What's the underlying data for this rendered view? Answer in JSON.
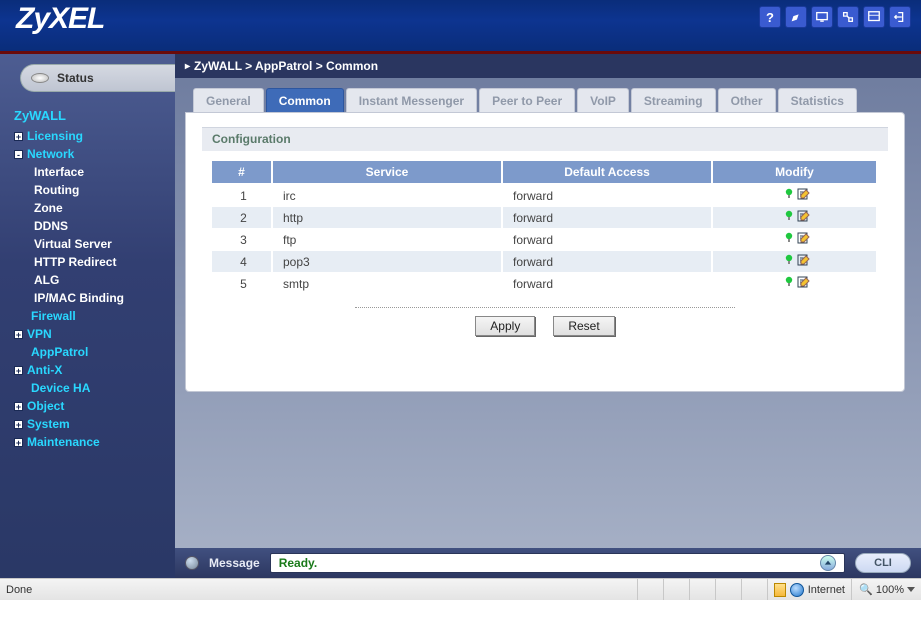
{
  "brand": "ZyXEL",
  "header_icons": [
    "help-icon",
    "wizard-icon",
    "console-icon",
    "connect-icon",
    "sitemap-icon",
    "logout-icon"
  ],
  "status_label": "Status",
  "breadcrumb": [
    "ZyWALL",
    "AppPatrol",
    "Common"
  ],
  "nav": {
    "root": "ZyWALL",
    "items": [
      {
        "label": "Licensing",
        "expandable": true,
        "sign": "+"
      },
      {
        "label": "Network",
        "expandable": true,
        "sign": "-",
        "children": [
          {
            "label": "Interface"
          },
          {
            "label": "Routing"
          },
          {
            "label": "Zone"
          },
          {
            "label": "DDNS"
          },
          {
            "label": "Virtual Server"
          },
          {
            "label": "HTTP Redirect"
          },
          {
            "label": "ALG"
          },
          {
            "label": "IP/MAC Binding"
          }
        ]
      },
      {
        "label": "Firewall",
        "expandable": false,
        "link": true
      },
      {
        "label": "VPN",
        "expandable": true,
        "sign": "+"
      },
      {
        "label": "AppPatrol",
        "expandable": false,
        "link": true,
        "active": true
      },
      {
        "label": "Anti-X",
        "expandable": true,
        "sign": "+"
      },
      {
        "label": "Device HA",
        "expandable": false,
        "link": true
      },
      {
        "label": "Object",
        "expandable": true,
        "sign": "+"
      },
      {
        "label": "System",
        "expandable": true,
        "sign": "+"
      },
      {
        "label": "Maintenance",
        "expandable": true,
        "sign": "+"
      }
    ]
  },
  "tabs": [
    {
      "label": "General",
      "active": false
    },
    {
      "label": "Common",
      "active": true
    },
    {
      "label": "Instant Messenger",
      "active": false
    },
    {
      "label": "Peer to Peer",
      "active": false
    },
    {
      "label": "VoIP",
      "active": false
    },
    {
      "label": "Streaming",
      "active": false
    },
    {
      "label": "Other",
      "active": false
    },
    {
      "label": "Statistics",
      "active": false
    }
  ],
  "section_title": "Configuration",
  "table": {
    "headers": [
      "#",
      "Service",
      "Default Access",
      "Modify"
    ],
    "rows": [
      {
        "num": "1",
        "service": "irc",
        "access": "forward"
      },
      {
        "num": "2",
        "service": "http",
        "access": "forward"
      },
      {
        "num": "3",
        "service": "ftp",
        "access": "forward"
      },
      {
        "num": "4",
        "service": "pop3",
        "access": "forward"
      },
      {
        "num": "5",
        "service": "smtp",
        "access": "forward"
      }
    ]
  },
  "buttons": {
    "apply": "Apply",
    "reset": "Reset"
  },
  "message_bar": {
    "label": "Message",
    "text": "Ready.",
    "cli": "CLI"
  },
  "ie_status": {
    "done": "Done",
    "zone": "Internet",
    "zoom": "100%"
  }
}
